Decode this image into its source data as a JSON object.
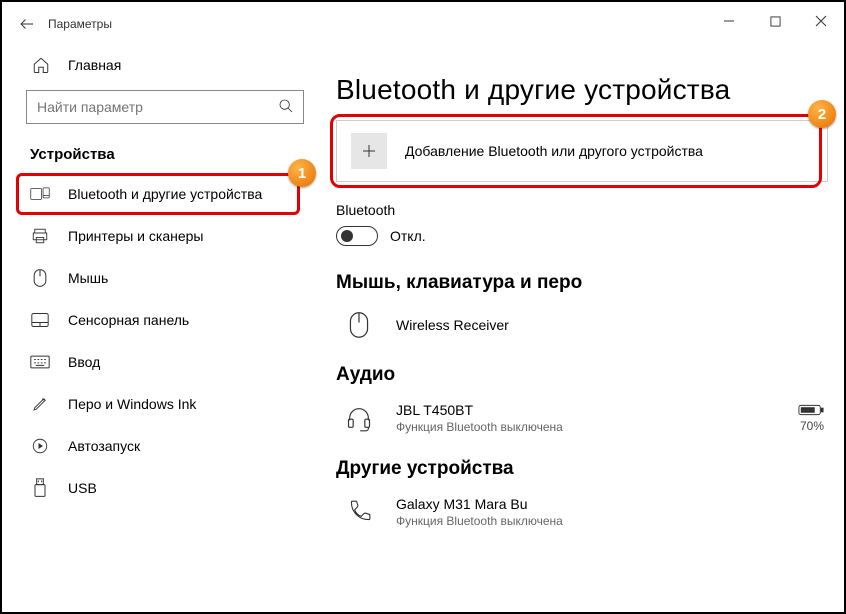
{
  "window": {
    "title": "Параметры"
  },
  "sidebar": {
    "home": "Главная",
    "search_placeholder": "Найти параметр",
    "section": "Устройства",
    "items": [
      {
        "label": "Bluetooth и другие устройства"
      },
      {
        "label": "Принтеры и сканеры"
      },
      {
        "label": "Мышь"
      },
      {
        "label": "Сенсорная панель"
      },
      {
        "label": "Ввод"
      },
      {
        "label": "Перо и Windows Ink"
      },
      {
        "label": "Автозапуск"
      },
      {
        "label": "USB"
      }
    ]
  },
  "main": {
    "title": "Bluetooth и другие устройства",
    "add_label": "Добавление Bluetooth или другого устройства",
    "bluetooth_heading": "Bluetooth",
    "bluetooth_state": "Откл.",
    "group1": "Мышь, клавиатура и перо",
    "device1": {
      "name": "Wireless Receiver"
    },
    "group2": "Аудио",
    "device2": {
      "name": "JBL T450BT",
      "status": "Функция Bluetooth выключена",
      "battery": "70%"
    },
    "group3": "Другие устройства",
    "device3": {
      "name": "Galaxy M31 Mara Bu",
      "status": "Функция Bluetooth выключена"
    }
  },
  "annotations": {
    "badge1": "1",
    "badge2": "2"
  }
}
